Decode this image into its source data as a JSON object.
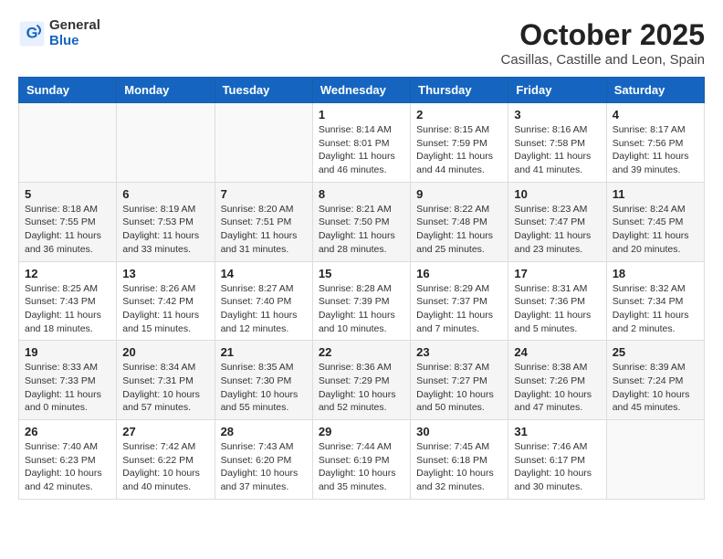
{
  "header": {
    "logo_general": "General",
    "logo_blue": "Blue",
    "month_title": "October 2025",
    "location": "Casillas, Castille and Leon, Spain"
  },
  "weekdays": [
    "Sunday",
    "Monday",
    "Tuesday",
    "Wednesday",
    "Thursday",
    "Friday",
    "Saturday"
  ],
  "weeks": [
    [
      {
        "day": "",
        "info": ""
      },
      {
        "day": "",
        "info": ""
      },
      {
        "day": "",
        "info": ""
      },
      {
        "day": "1",
        "info": "Sunrise: 8:14 AM\nSunset: 8:01 PM\nDaylight: 11 hours and 46 minutes."
      },
      {
        "day": "2",
        "info": "Sunrise: 8:15 AM\nSunset: 7:59 PM\nDaylight: 11 hours and 44 minutes."
      },
      {
        "day": "3",
        "info": "Sunrise: 8:16 AM\nSunset: 7:58 PM\nDaylight: 11 hours and 41 minutes."
      },
      {
        "day": "4",
        "info": "Sunrise: 8:17 AM\nSunset: 7:56 PM\nDaylight: 11 hours and 39 minutes."
      }
    ],
    [
      {
        "day": "5",
        "info": "Sunrise: 8:18 AM\nSunset: 7:55 PM\nDaylight: 11 hours and 36 minutes."
      },
      {
        "day": "6",
        "info": "Sunrise: 8:19 AM\nSunset: 7:53 PM\nDaylight: 11 hours and 33 minutes."
      },
      {
        "day": "7",
        "info": "Sunrise: 8:20 AM\nSunset: 7:51 PM\nDaylight: 11 hours and 31 minutes."
      },
      {
        "day": "8",
        "info": "Sunrise: 8:21 AM\nSunset: 7:50 PM\nDaylight: 11 hours and 28 minutes."
      },
      {
        "day": "9",
        "info": "Sunrise: 8:22 AM\nSunset: 7:48 PM\nDaylight: 11 hours and 25 minutes."
      },
      {
        "day": "10",
        "info": "Sunrise: 8:23 AM\nSunset: 7:47 PM\nDaylight: 11 hours and 23 minutes."
      },
      {
        "day": "11",
        "info": "Sunrise: 8:24 AM\nSunset: 7:45 PM\nDaylight: 11 hours and 20 minutes."
      }
    ],
    [
      {
        "day": "12",
        "info": "Sunrise: 8:25 AM\nSunset: 7:43 PM\nDaylight: 11 hours and 18 minutes."
      },
      {
        "day": "13",
        "info": "Sunrise: 8:26 AM\nSunset: 7:42 PM\nDaylight: 11 hours and 15 minutes."
      },
      {
        "day": "14",
        "info": "Sunrise: 8:27 AM\nSunset: 7:40 PM\nDaylight: 11 hours and 12 minutes."
      },
      {
        "day": "15",
        "info": "Sunrise: 8:28 AM\nSunset: 7:39 PM\nDaylight: 11 hours and 10 minutes."
      },
      {
        "day": "16",
        "info": "Sunrise: 8:29 AM\nSunset: 7:37 PM\nDaylight: 11 hours and 7 minutes."
      },
      {
        "day": "17",
        "info": "Sunrise: 8:31 AM\nSunset: 7:36 PM\nDaylight: 11 hours and 5 minutes."
      },
      {
        "day": "18",
        "info": "Sunrise: 8:32 AM\nSunset: 7:34 PM\nDaylight: 11 hours and 2 minutes."
      }
    ],
    [
      {
        "day": "19",
        "info": "Sunrise: 8:33 AM\nSunset: 7:33 PM\nDaylight: 11 hours and 0 minutes."
      },
      {
        "day": "20",
        "info": "Sunrise: 8:34 AM\nSunset: 7:31 PM\nDaylight: 10 hours and 57 minutes."
      },
      {
        "day": "21",
        "info": "Sunrise: 8:35 AM\nSunset: 7:30 PM\nDaylight: 10 hours and 55 minutes."
      },
      {
        "day": "22",
        "info": "Sunrise: 8:36 AM\nSunset: 7:29 PM\nDaylight: 10 hours and 52 minutes."
      },
      {
        "day": "23",
        "info": "Sunrise: 8:37 AM\nSunset: 7:27 PM\nDaylight: 10 hours and 50 minutes."
      },
      {
        "day": "24",
        "info": "Sunrise: 8:38 AM\nSunset: 7:26 PM\nDaylight: 10 hours and 47 minutes."
      },
      {
        "day": "25",
        "info": "Sunrise: 8:39 AM\nSunset: 7:24 PM\nDaylight: 10 hours and 45 minutes."
      }
    ],
    [
      {
        "day": "26",
        "info": "Sunrise: 7:40 AM\nSunset: 6:23 PM\nDaylight: 10 hours and 42 minutes."
      },
      {
        "day": "27",
        "info": "Sunrise: 7:42 AM\nSunset: 6:22 PM\nDaylight: 10 hours and 40 minutes."
      },
      {
        "day": "28",
        "info": "Sunrise: 7:43 AM\nSunset: 6:20 PM\nDaylight: 10 hours and 37 minutes."
      },
      {
        "day": "29",
        "info": "Sunrise: 7:44 AM\nSunset: 6:19 PM\nDaylight: 10 hours and 35 minutes."
      },
      {
        "day": "30",
        "info": "Sunrise: 7:45 AM\nSunset: 6:18 PM\nDaylight: 10 hours and 32 minutes."
      },
      {
        "day": "31",
        "info": "Sunrise: 7:46 AM\nSunset: 6:17 PM\nDaylight: 10 hours and 30 minutes."
      },
      {
        "day": "",
        "info": ""
      }
    ]
  ]
}
